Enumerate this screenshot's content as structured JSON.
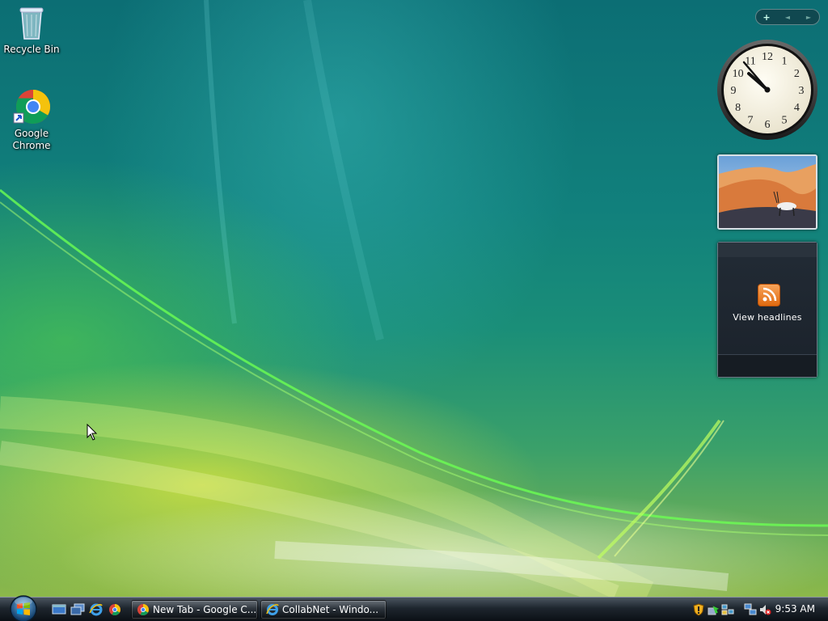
{
  "desktop": {
    "icons": [
      {
        "label": "Recycle Bin",
        "icon": "recycle-bin-icon"
      },
      {
        "label_line1": "Google",
        "label_line2": "Chrome",
        "icon": "chrome-icon"
      }
    ]
  },
  "sidebar": {
    "toolbar": {
      "add": "+",
      "prev": "◄",
      "next": "►"
    },
    "clock": {
      "time_shown": "9:53",
      "numerals": [
        "12",
        "1",
        "2",
        "3",
        "4",
        "5",
        "6",
        "7",
        "8",
        "9",
        "10",
        "11"
      ]
    },
    "slideshow": {
      "icon": "slideshow-photo"
    },
    "feeds": {
      "label": "View headlines",
      "icon": "rss-icon"
    }
  },
  "taskbar": {
    "start_icon": "windows-orb-icon",
    "quick_launch": [
      "show-desktop-icon",
      "switch-windows-icon",
      "internet-explorer-icon",
      "chrome-icon"
    ],
    "tasks": [
      {
        "label": "New Tab - Google C...",
        "icon": "chrome-icon"
      },
      {
        "label": "CollabNet - Windo...",
        "icon": "internet-explorer-icon"
      }
    ],
    "tray": {
      "icons": [
        "windows-security-icon",
        "update-icon",
        "network-sharing-icon",
        "network-icon",
        "volume-muted-icon"
      ],
      "time": "9:53 AM"
    }
  }
}
